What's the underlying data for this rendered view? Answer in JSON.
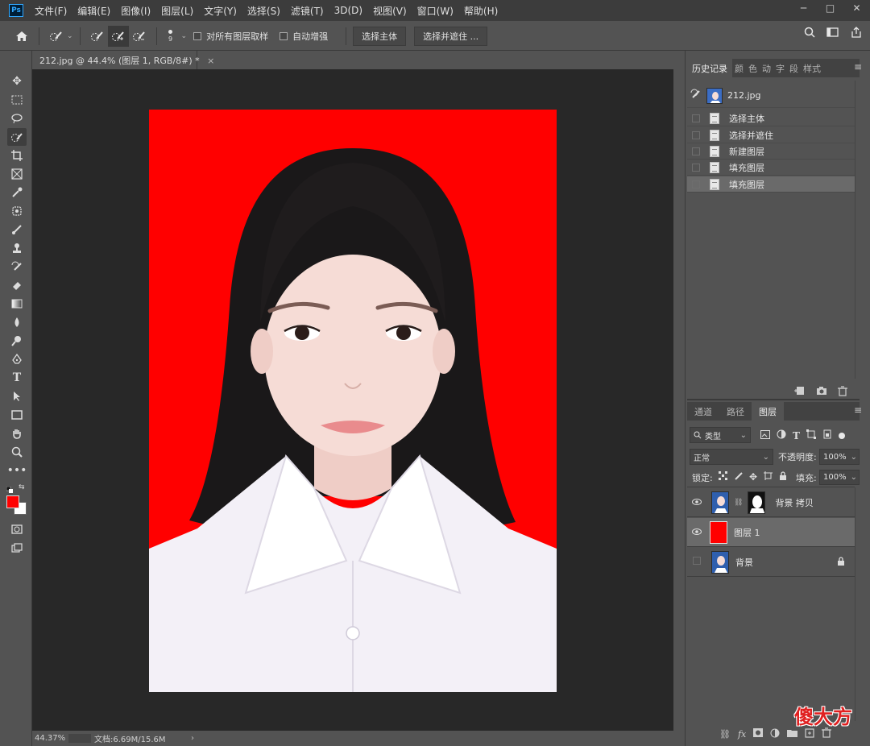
{
  "app": {
    "logo": "Ps"
  },
  "menu": [
    "文件(F)",
    "编辑(E)",
    "图像(I)",
    "图层(L)",
    "文字(Y)",
    "选择(S)",
    "滤镜(T)",
    "3D(D)",
    "视图(V)",
    "窗口(W)",
    "帮助(H)"
  ],
  "window_controls": {
    "minimize": "─",
    "maximize": "□",
    "close": "✕"
  },
  "options_bar": {
    "brush_size": "9",
    "sample_all_layers_label": "对所有图层取样",
    "auto_enhance_label": "自动增强",
    "select_subject_button": "选择主体",
    "select_and_mask_button": "选择并遮住 ..."
  },
  "document": {
    "tab_title": "212.jpg @ 44.4% (图层 1, RGB/8#) *",
    "tab_close": "×",
    "canvas_color": "#ff0000"
  },
  "status_bar": {
    "zoom": "44.37%",
    "doc_size": "文档:6.69M/15.6M",
    "arrow": "›"
  },
  "history_panel": {
    "tabs": [
      "历史记录",
      "颜",
      "色",
      "动",
      "字",
      "段",
      "样",
      "式"
    ],
    "snapshot_name": "212.jpg",
    "steps": [
      "选择主体",
      "选择并遮住",
      "新建图层",
      "填充图层",
      "填充图层"
    ],
    "selected_index": 4
  },
  "layers_panel": {
    "tabs": [
      "通道",
      "路径",
      "图层"
    ],
    "filter_kind": "类型",
    "blend_mode": "正常",
    "opacity_label": "不透明度:",
    "opacity_value": "100%",
    "lock_label": "锁定:",
    "fill_label": "填充:",
    "fill_value": "100%",
    "layers": [
      {
        "name": "背景 拷贝",
        "visible": true,
        "has_mask": true
      },
      {
        "name": "图层 1",
        "visible": true,
        "fill_color": "#ff0000"
      },
      {
        "name": "背景",
        "visible": false,
        "locked": true
      }
    ],
    "selected_index": 1
  },
  "watermark": {
    "text": "傻大方"
  },
  "colors": {
    "foreground": "#ff0000",
    "background": "#ffffff",
    "accent": "#31a8ff"
  }
}
